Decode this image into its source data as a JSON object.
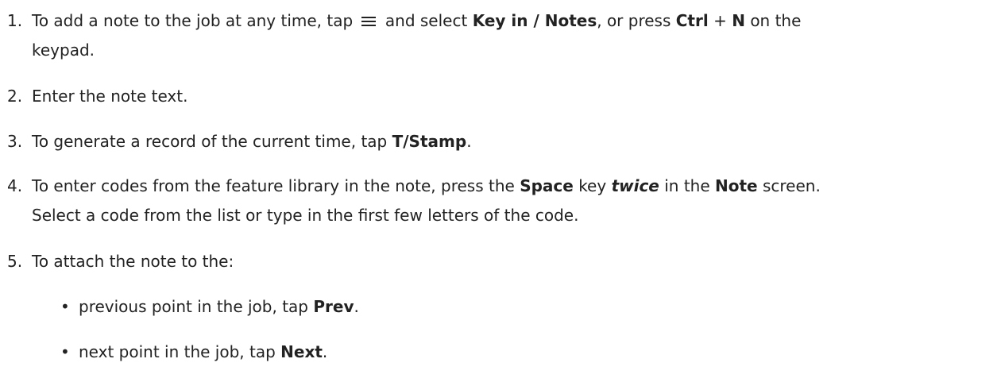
{
  "steps": [
    {
      "number": "1.",
      "line1": {
        "a": "To add a note to the job at any time, tap",
        "icon": "menu-icon",
        "b": "and select",
        "bold1": "Key in / Notes",
        "c": ", or press",
        "bold2": "Ctrl",
        "d": "+",
        "bold3": "N",
        "e": "on the"
      },
      "line2": "keypad."
    },
    {
      "number": "2.",
      "text": "Enter the note text."
    },
    {
      "number": "3.",
      "a": "To generate a record of the current time, tap",
      "bold": "T/Stamp",
      "end": "."
    },
    {
      "number": "4.",
      "line1": {
        "a": "To enter codes from the feature library in the note, press the",
        "bold1": "Space",
        "b": "key",
        "emph": "twice",
        "c": "in the",
        "bold2": "Note",
        "d": "screen."
      },
      "line2": "Select a code from the list or type in the first few letters of the code."
    },
    {
      "number": "5.",
      "text": "To attach the note to the:"
    }
  ],
  "bullets": [
    {
      "marker": "•",
      "a": "previous point in the job, tap",
      "bold": "Prev",
      "end": "."
    },
    {
      "marker": "•",
      "a": "next point in the job, tap",
      "bold": "Next",
      "end": "."
    }
  ]
}
